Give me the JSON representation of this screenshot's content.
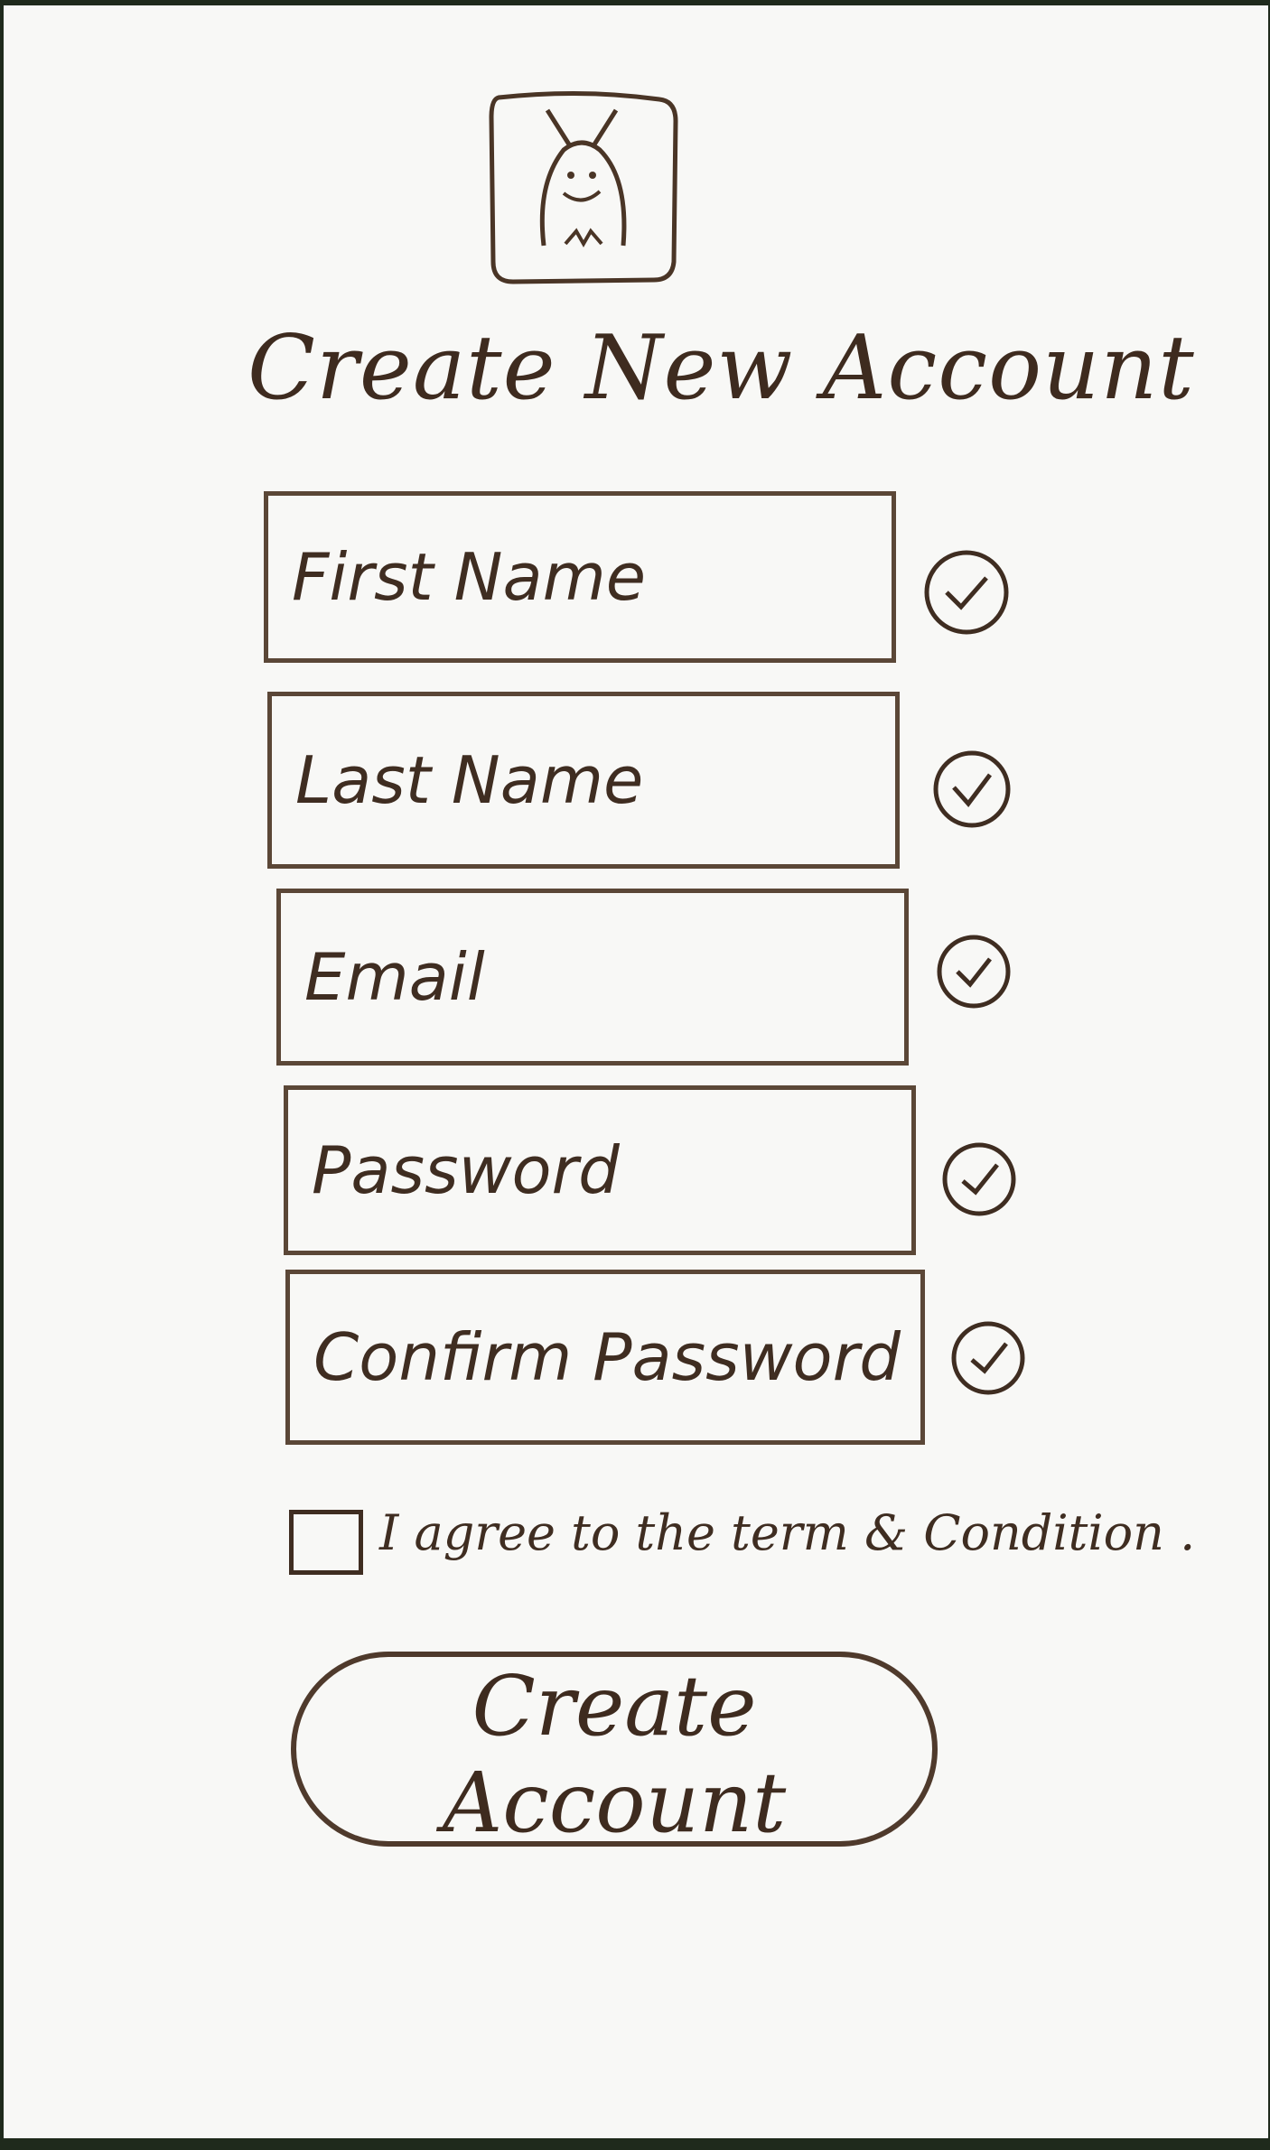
{
  "header": {
    "logo_icon": "mascot-bug-icon",
    "title": "Create New Account"
  },
  "form": {
    "fields": [
      {
        "placeholder": "First Name",
        "status_icon": "check-circle-icon"
      },
      {
        "placeholder": "Last Name",
        "status_icon": "check-circle-icon"
      },
      {
        "placeholder": "Email",
        "status_icon": "check-circle-icon"
      },
      {
        "placeholder": "Password",
        "status_icon": "check-circle-icon"
      },
      {
        "placeholder": "Confirm Password",
        "status_icon": "check-circle-icon"
      }
    ],
    "terms_checked": false,
    "terms_label": "I agree to the term & Condition .",
    "submit_label": "Create Account"
  },
  "colors": {
    "ink": "#3f2d21",
    "paper": "#f8f8f6",
    "background": "#1f2a1c"
  }
}
